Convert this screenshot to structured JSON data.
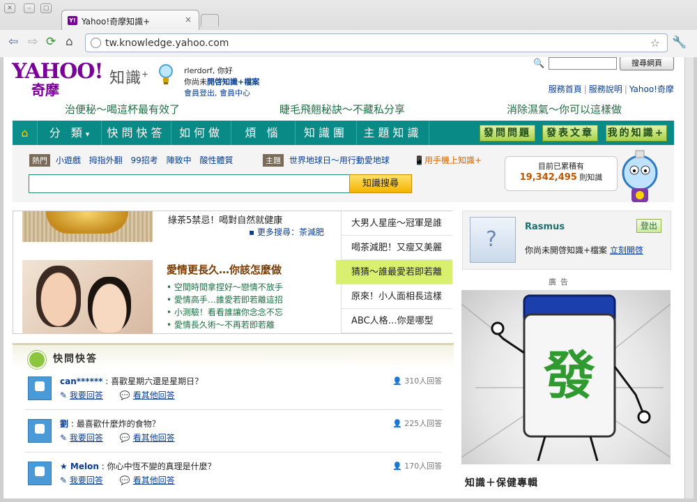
{
  "browser": {
    "tab_title": "Yahoo!奇摩知識+",
    "favicon_text": "Y!",
    "url": "tw.knowledge.yahoo.com",
    "tab_close": "×"
  },
  "header": {
    "logo_text": "YAHOO!",
    "logo_sub": "奇摩",
    "brand": "知識",
    "brand_sup": "+",
    "greeting": "rlerdorf, 你好",
    "notice_pre": "你尚未",
    "notice_strong": "開啓知識+檔案",
    "account_links": "會員登出, 會員中心",
    "search_button": "搜尋網頁",
    "top_links": [
      "服務首頁",
      "服務說明",
      "Yahoo!奇摩"
    ]
  },
  "ads_row": [
    "治便秘～喝這杯最有效了",
    "睫毛飛翹秘訣～不藏私分享",
    "消除濕氣～你可以這樣做"
  ],
  "nav": {
    "home_icon": "home-icon",
    "items": [
      "分 類",
      "快問快答",
      "如何做",
      "煩 惱",
      "知識團",
      "主題知識"
    ],
    "dropdown_glyph": "▾",
    "actions": [
      "發問問題",
      "發表文章",
      "我的知識+"
    ]
  },
  "subbar": {
    "hot_tag": "熱門",
    "hot_keywords": [
      "小遊戲",
      "拇指外翻",
      "99招考",
      "陣致中",
      "酸性體質"
    ],
    "topic_tag": "主題",
    "topic_text": "世界地球日～用行動愛地球",
    "mobile_text": "用手機上知識+",
    "search_button": "知識搜尋",
    "counter_label": "目前已累積有",
    "counter_value": "19,342,495",
    "counter_unit": "則知識"
  },
  "feature": {
    "item1_title": "綠茶5禁忌！喝對自然就健康",
    "item1_more": "更多搜尋：茶減肥",
    "title": "愛情更長久…你該怎麼做",
    "list": [
      "空間時間拿捏好～戀情不放手",
      "愛情高手…誰愛若即若離這招",
      "小測驗！看看誰讓你念念不忘",
      "愛情長久術～不再若即若離"
    ],
    "tabs": [
      "大男人星座～冠軍是誰",
      "喝茶減肥！又瘦又美麗",
      "猜猜～誰最愛若即若離",
      "原來！小人面相長這樣",
      "ABC人格…你是哪型"
    ],
    "active_tab": 2
  },
  "qa": {
    "title": "快問快答",
    "answer_link": "我要回答",
    "other_link": "看其他回答",
    "rows": [
      {
        "user": "can******",
        "question": "喜歡星期六還是星期日？",
        "count": "310人回答"
      },
      {
        "user": "劉",
        "question": "最喜歡什麼炸的食物？",
        "count": "225人回答"
      },
      {
        "user": "★ Melon",
        "question": "你心中恆不變的真理是什麼？",
        "count": "170人回答"
      }
    ]
  },
  "right": {
    "username": "Rasmus",
    "logout": "登出",
    "msg": "你尚未開啓知識+檔案",
    "open_link": "立刻開啓",
    "ad_label": "廣告",
    "ad_glyph": "發",
    "health_title": "知識＋保健專輯"
  },
  "colors": {
    "brand_purple": "#7b0099",
    "nav_teal": "#0a8a86",
    "link_blue": "#0a3d91",
    "green_text": "#1e6f44",
    "active_tab": "#d9ef6e"
  }
}
